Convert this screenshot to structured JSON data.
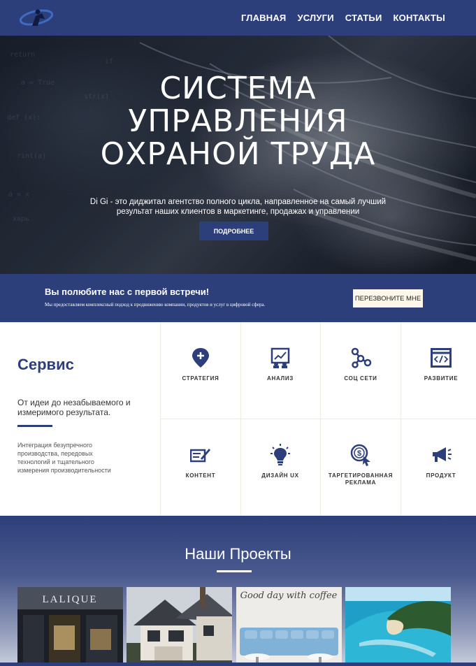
{
  "nav": {
    "items": [
      "ГЛАВНАЯ",
      "УСЛУГИ",
      "СТАТЬИ",
      "КОНТАКТЫ"
    ]
  },
  "hero": {
    "title_lines": [
      "СИСТЕМА",
      "УПРАВЛЕНИЯ",
      "ОХРАНОЙ ТРУДА"
    ],
    "text_line1": "Di Gi - это диджитал агентство полного цикла, направленное на самый лучший",
    "text_line2": "результат наших клиентов в маркетинге, продажах и управлении",
    "button": "ПОДРОБНЕЕ"
  },
  "cta": {
    "title": "Вы полюбите нас с первой встречи!",
    "text": "Мы предоставляем комплексный подход к продвижению компании, продуктов и услуг в цифровой сфера.",
    "button": "ПЕРЕЗВОНИТЕ МНЕ"
  },
  "services": {
    "title": "Сервис",
    "tagline": "От идеи до незабываемого и измеримого результата.",
    "description": "Интеграция безупречного производства, передовых технологий и тщательного измерения производительности",
    "items": [
      {
        "label": "СТРАТЕГИЯ",
        "icon": "strategy-pin-icon"
      },
      {
        "label": "АНАЛИЗ",
        "icon": "analysis-board-icon"
      },
      {
        "label": "СОЦ СЕТИ",
        "icon": "social-network-icon"
      },
      {
        "label": "РАЗВИТИЕ",
        "icon": "code-window-icon"
      },
      {
        "label": "КОНТЕНТ",
        "icon": "content-pen-icon"
      },
      {
        "label": "ДИЗАЙН UX",
        "icon": "lightbulb-icon"
      },
      {
        "label": "ТАРГЕТИРОВАННАЯ РЕКЛАМА",
        "icon": "dollar-cursor-icon"
      },
      {
        "label": "ПРОДУКТ",
        "icon": "megaphone-icon"
      }
    ],
    "icon_color": "#2d3f7a"
  },
  "projects": {
    "title": "Наши Проекты",
    "items": [
      {
        "sign": "LALIQUE"
      },
      {
        "sign": ""
      },
      {
        "sign": "Good day with coffee"
      },
      {
        "sign": ""
      }
    ]
  },
  "colors": {
    "brand": "#2d3f7a",
    "cta_button_bg": "#fff8ea"
  }
}
